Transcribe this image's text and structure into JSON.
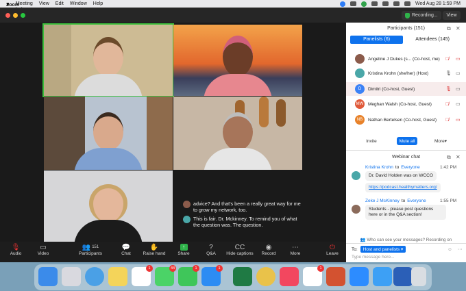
{
  "menubar": {
    "items": [
      "Zoom Workplace",
      "Meeting",
      "View",
      "Edit",
      "Window",
      "Help"
    ],
    "clock": "Wed Aug 28  1:59 PM"
  },
  "titlebar": {
    "recording": "Recording...",
    "view": "View"
  },
  "captions": [
    {
      "text": "advice? And that's been a really great way for me to grow my network, too."
    },
    {
      "text": "This is fair. Dr. Mckinney. To remind you of what the question was. The question."
    }
  ],
  "toolbar": {
    "audio": "Audio",
    "video": "Video",
    "participants": "Participants",
    "participants_count": "151",
    "chat": "Chat",
    "raise_hand": "Raise hand",
    "share": "Share",
    "qa": "Q&A",
    "captions": "Hide captions",
    "record": "Record",
    "more": "More",
    "leave": "Leave"
  },
  "participants": {
    "title": "Participants (151)",
    "tab_panelists": "Panelists (6)",
    "tab_attendees": "Attendees (145)",
    "rows": [
      {
        "name": "Angeline J Dukes (s...  (Co-host, me)",
        "avatar": ""
      },
      {
        "name": "Kristina Krohn (she/her) (Host)",
        "avatar": ""
      },
      {
        "name": "Dimitri (Co-host, Guest)",
        "avatar": "D"
      },
      {
        "name": "Meghan Walsh (Co-host, Guest)",
        "avatar": "MW"
      },
      {
        "name": "Nathan Bertelsen (Co-host, Guest)",
        "avatar": "NB"
      }
    ],
    "invite": "Invite",
    "mute_all": "Mute all",
    "more": "More"
  },
  "chat": {
    "title": "Webinar chat",
    "messages": [
      {
        "sender": "Kristina Krohn",
        "to": "to",
        "recipient": "Everyone",
        "time": "1:42 PM",
        "text": "Dr. David Holden was on WCCO"
      },
      {
        "link": "https://podcast.healthymatters.org/"
      },
      {
        "sender": "Zeke J McKinney",
        "to": "to",
        "recipient": "Everyone",
        "time": "1:55 PM",
        "text": "Students - please post questions here or in the Q&A section!"
      }
    ],
    "who_can_see": "Who can see your messages? Recording on",
    "to_label": "To:",
    "to_value": "Host and panelists",
    "placeholder": "Type message here..."
  },
  "dock": {
    "badges": [
      "1",
      "44",
      "1",
      "1",
      "1"
    ]
  },
  "colors": {
    "accent": "#0e72ed",
    "active_speaker": "#3cbf3c",
    "leave": "#e33"
  }
}
